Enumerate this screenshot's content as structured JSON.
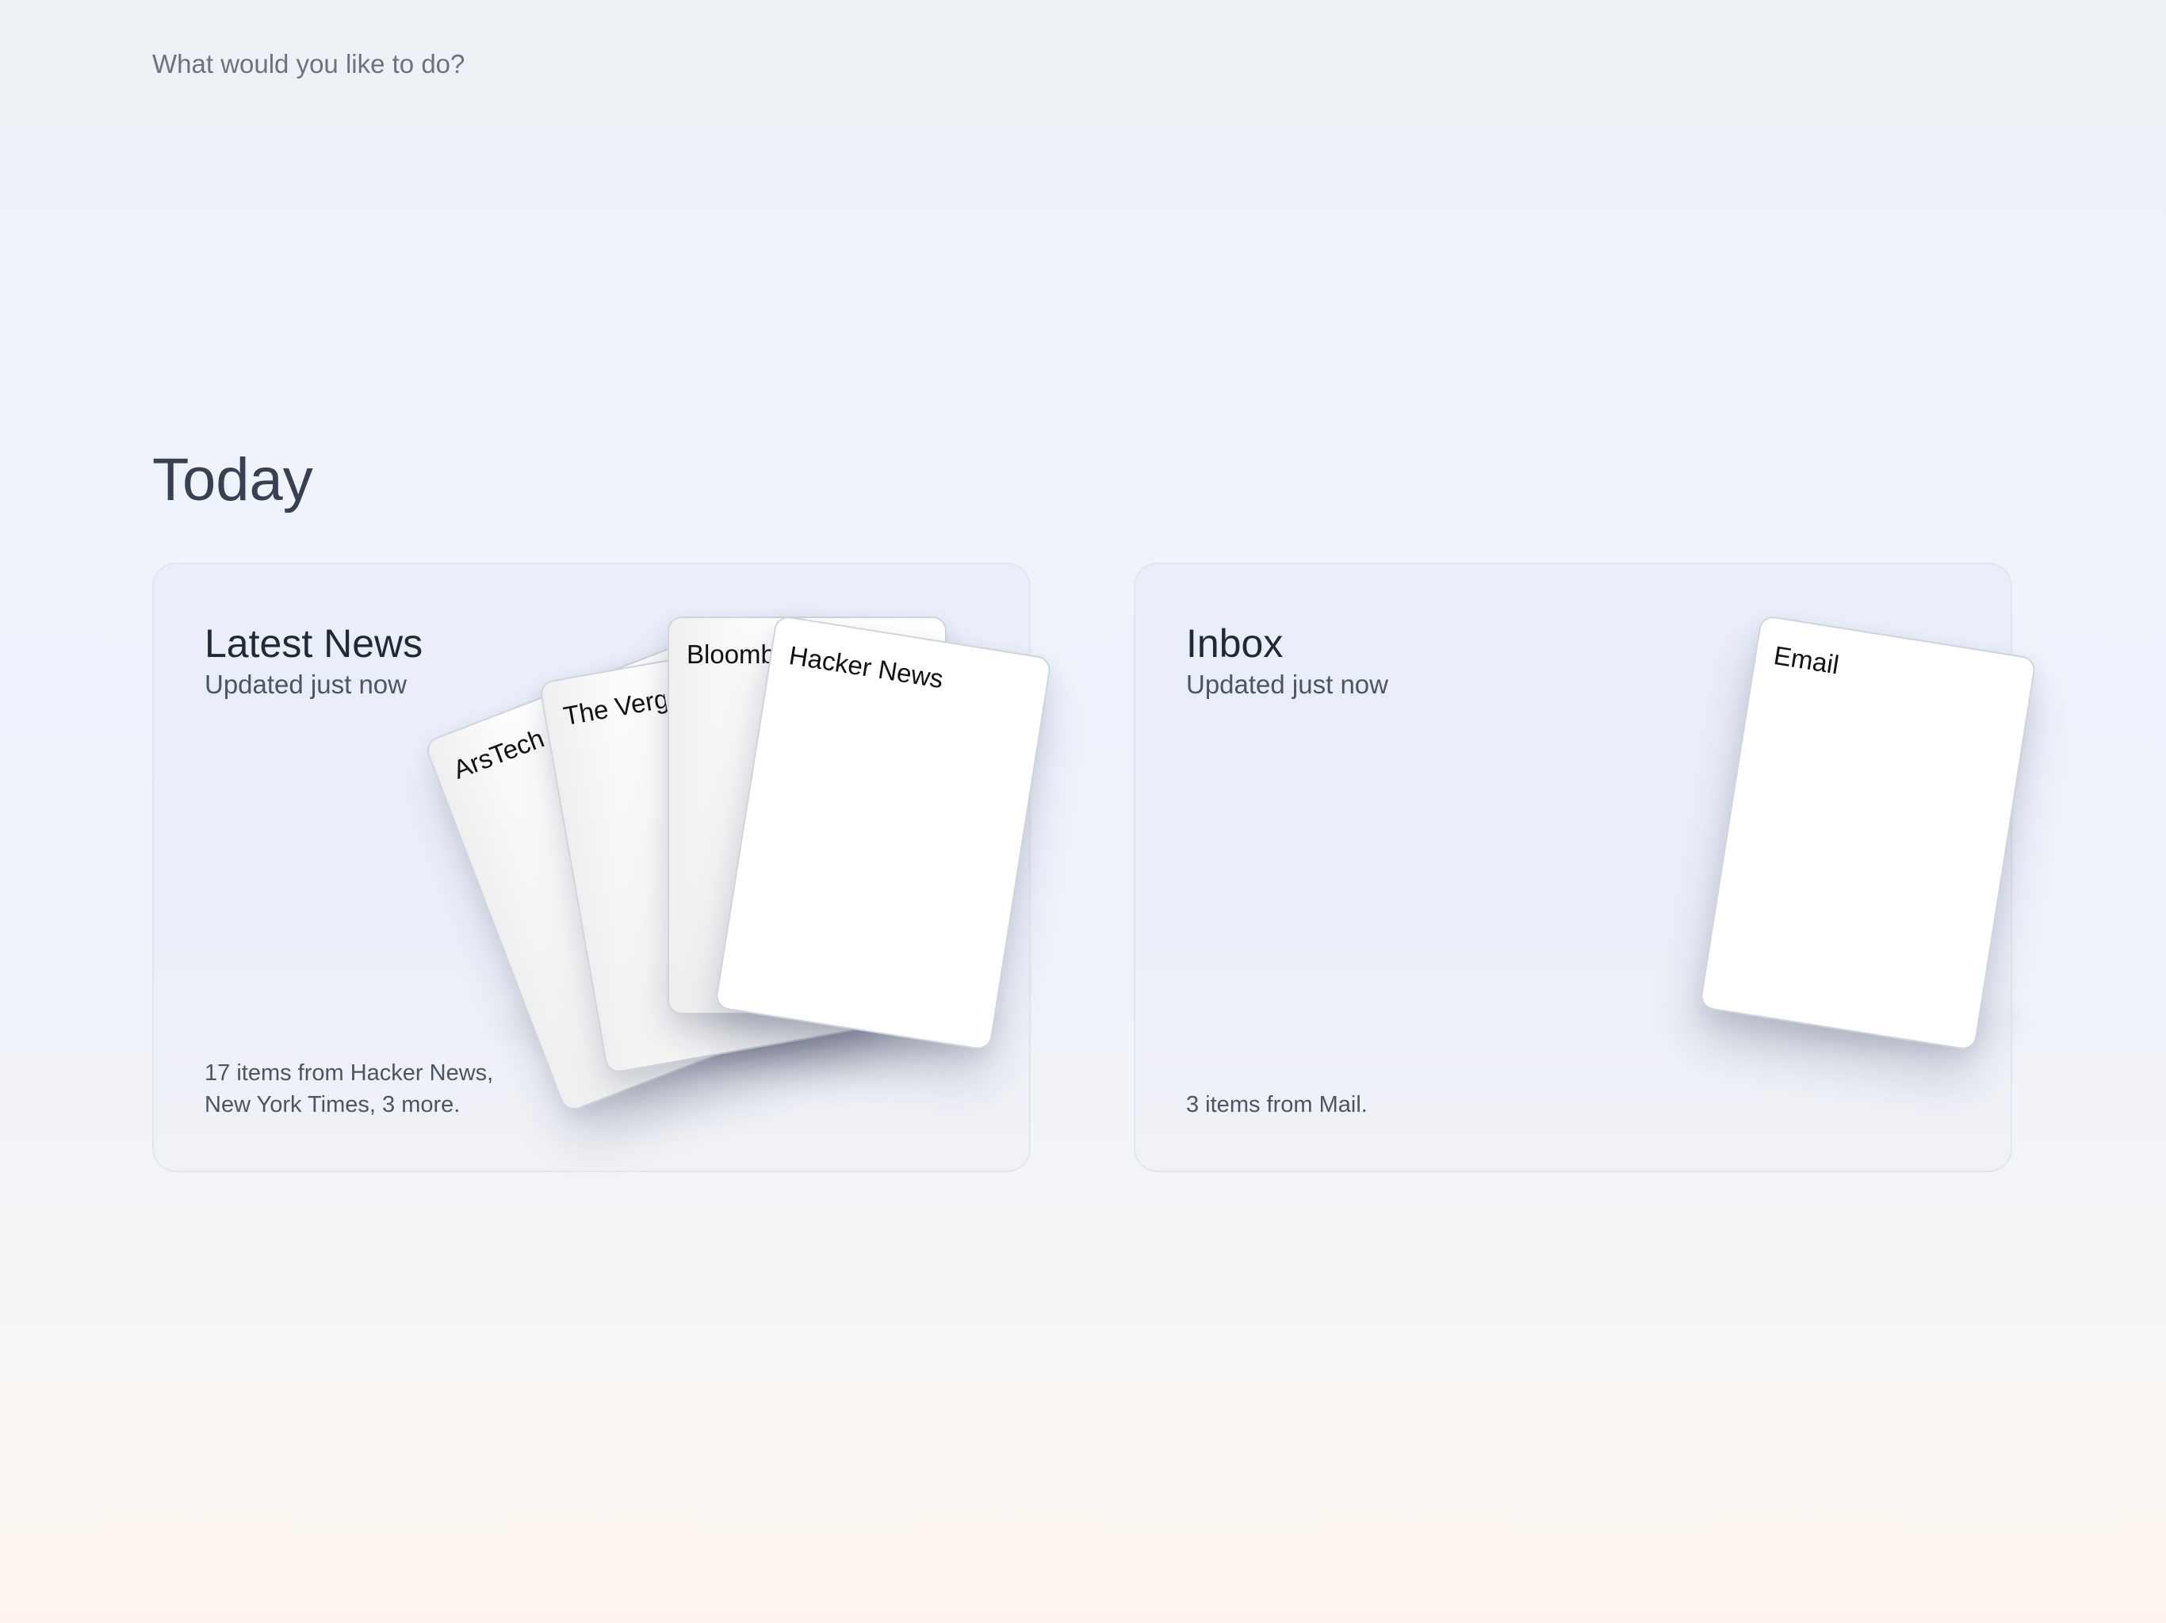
{
  "search": {
    "placeholder": "What would you like to do?"
  },
  "section": {
    "title": "Today"
  },
  "news_panel": {
    "title": "Latest News",
    "subtitle": "Updated just now",
    "summary_line1": "17 items from Hacker News,",
    "summary_line2": "New York Times, 3 more.",
    "cards": [
      {
        "label": "ArsTechnica"
      },
      {
        "label": "The Verge"
      },
      {
        "label": "Bloomberg"
      },
      {
        "label": "Hacker News"
      }
    ]
  },
  "inbox_panel": {
    "title": "Inbox",
    "subtitle": "Updated just now",
    "summary": "3 items from Mail.",
    "cards": [
      {
        "label": "Email"
      }
    ]
  }
}
